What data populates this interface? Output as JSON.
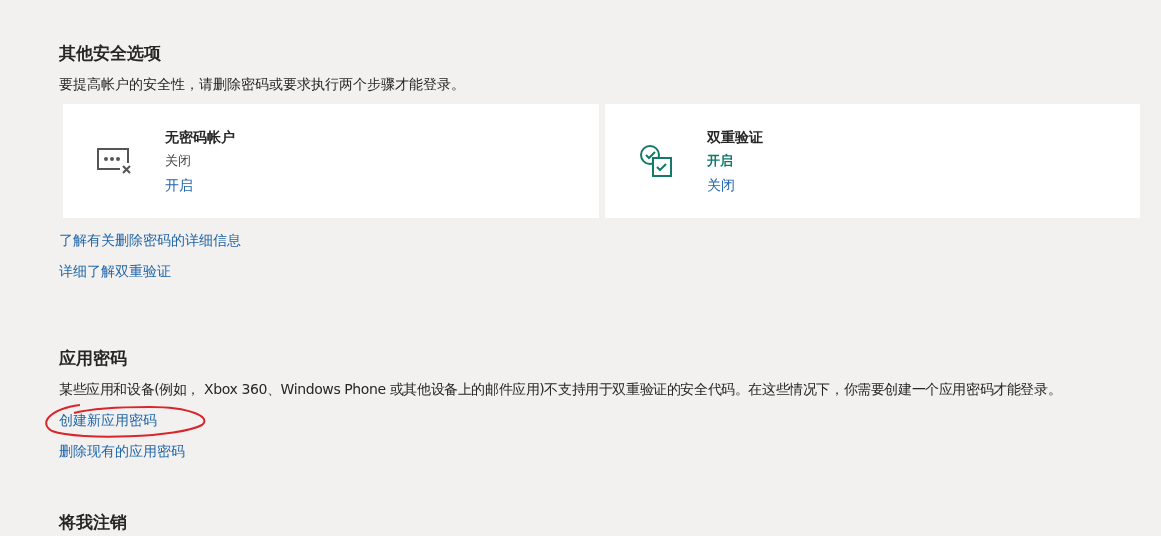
{
  "security_options": {
    "title": "其他安全选项",
    "description": "要提高帐户的安全性，请删除密码或要求执行两个步骤才能登录。",
    "cards": [
      {
        "kind": "passwordless",
        "title": "无密码帐户",
        "on": false,
        "status": "关闭",
        "action": "开启"
      },
      {
        "kind": "two_step",
        "title": "双重验证",
        "on": true,
        "status": "开启",
        "action": "关闭"
      }
    ],
    "links": [
      "了解有关删除密码的详细信息",
      "详细了解双重验证"
    ]
  },
  "app_passwords": {
    "title": "应用密码",
    "description": "某些应用和设备(例如， Xbox 360、Windows Phone 或其他设备上的邮件应用)不支持用于双重验证的安全代码。在这些情况下，你需要创建一个应用密码才能登录。",
    "links": [
      {
        "label": "创建新应用密码",
        "circled": true
      },
      {
        "label": "删除现有的应用密码",
        "circled": false
      }
    ]
  },
  "sign_out": {
    "title": "将我注销"
  }
}
